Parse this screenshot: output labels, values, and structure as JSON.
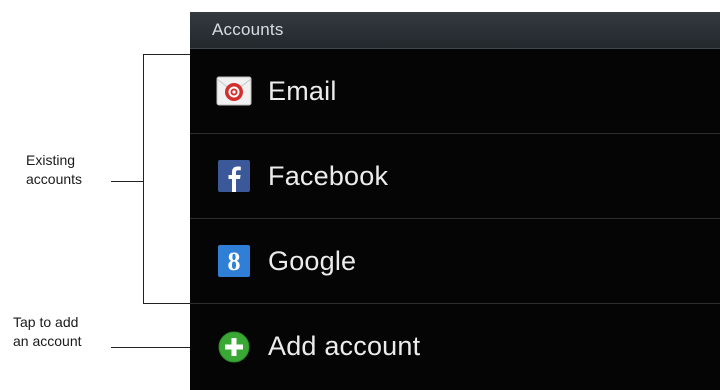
{
  "annotations": {
    "existing_line1": "Existing",
    "existing_line2": "accounts",
    "add_line1": "Tap to add",
    "add_line2": "an account"
  },
  "panel": {
    "header_title": "Accounts",
    "accounts": [
      {
        "label": "Email",
        "icon": "email-icon"
      },
      {
        "label": "Facebook",
        "icon": "facebook-icon"
      },
      {
        "label": "Google",
        "icon": "google-icon"
      }
    ],
    "add_account_label": "Add account",
    "add_account_icon": "add-circle-icon"
  },
  "colors": {
    "panel_bg": "#050505",
    "header_bg": "#2c3237",
    "facebook_blue": "#3b5998",
    "google_blue": "#2f7fd6",
    "add_green": "#3aa835",
    "email_red": "#d32f2f"
  }
}
